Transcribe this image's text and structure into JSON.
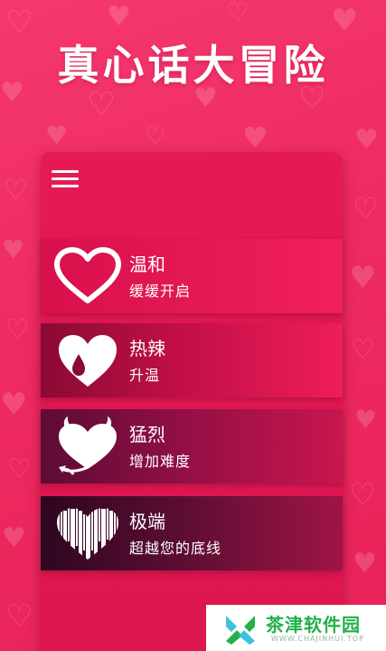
{
  "app": {
    "title": "真心话大冒险"
  },
  "menu": {
    "icon": "menu-icon"
  },
  "levels": [
    {
      "name": "温和",
      "description": "缓缓开启",
      "icon": "outline-heart-icon"
    },
    {
      "name": "热辣",
      "description": "升温",
      "icon": "drop-heart-icon"
    },
    {
      "name": "猛烈",
      "description": "增加难度",
      "icon": "devil-heart-icon"
    },
    {
      "name": "极端",
      "description": "超越您的底线",
      "icon": "glitch-heart-icon"
    }
  ],
  "watermark": {
    "title": "茶津软件园",
    "subtitle": "WWW.CHAJINHUI.TOP"
  },
  "colors": {
    "background": "#ee2a62",
    "panel": "#e51a55",
    "watermark_green": "#22b04a"
  }
}
